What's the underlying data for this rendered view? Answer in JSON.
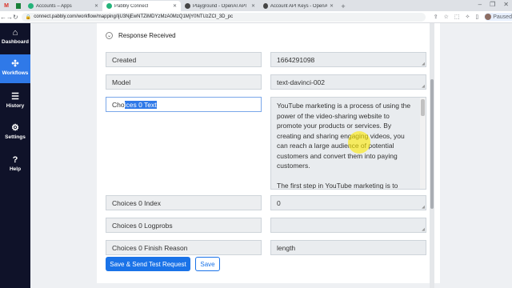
{
  "browser": {
    "tabs": [
      {
        "label": "",
        "icon": "gmail-icon"
      },
      {
        "label": "",
        "icon": "sheets-icon"
      },
      {
        "label": "Accounts – Apps"
      },
      {
        "label": "Pabbly Connect"
      },
      {
        "label": "Playground - OpenAI API"
      },
      {
        "label": "Account API Keys - OpenAI API"
      }
    ],
    "new_tab": "+",
    "url": "connect.pabbly.com/workflow/mapping/IjU3NjEwNTZiMDYzMzA0MzQ1MjY0NTUzZCI_3D_pc",
    "profile_status": "Paused"
  },
  "sidebar": {
    "items": [
      {
        "label": "Dashboard",
        "icon": "home-icon"
      },
      {
        "label": "Workflows",
        "icon": "workflow-icon"
      },
      {
        "label": "History",
        "icon": "history-icon"
      },
      {
        "label": "Settings",
        "icon": "gear-icon"
      },
      {
        "label": "Help",
        "icon": "help-icon"
      }
    ]
  },
  "section": {
    "title": "Response Received"
  },
  "fields": [
    {
      "label": "Created",
      "value": "1664291098"
    },
    {
      "label": "Model",
      "value": "text-davinci-002"
    },
    {
      "label_before": "Cho",
      "label_selected": "ices 0 Text"
    },
    {
      "label": "Choices 0 Index",
      "value": "0"
    },
    {
      "label": "Choices 0 Logprobs",
      "value": ""
    },
    {
      "label": "Choices 0 Finish Reason",
      "value": "length"
    }
  ],
  "choices_text": {
    "p1": "YouTube marketing is a process of using the power of the video-sharing website to promote your products or services. By creating and sharing engaging videos, you can reach a large audience of potential customers and convert them into paying customers.",
    "p2": "The first step in YouTube marketing is to"
  },
  "buttons": {
    "primary": "Save & Send Test Request",
    "secondary": "Save"
  }
}
